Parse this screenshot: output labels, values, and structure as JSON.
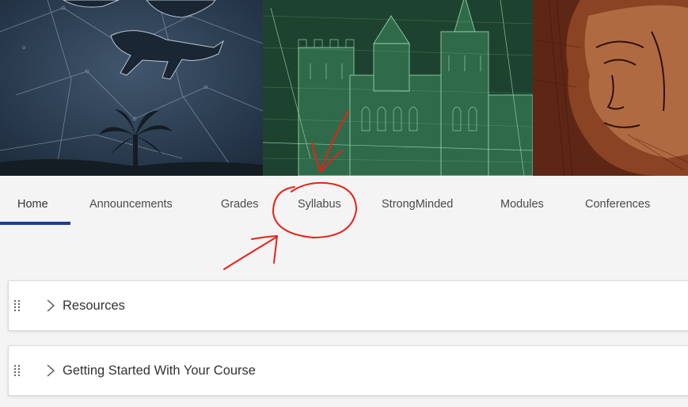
{
  "nav": {
    "tabs": [
      {
        "label": "Home",
        "active": true
      },
      {
        "label": "Announcements",
        "active": false
      },
      {
        "label": "Grades",
        "active": false
      },
      {
        "label": "Syllabus",
        "active": false
      },
      {
        "label": "StrongMinded",
        "active": false
      },
      {
        "label": "Modules",
        "active": false
      },
      {
        "label": "Conferences",
        "active": false
      }
    ]
  },
  "modules": [
    {
      "title": "Resources",
      "expanded": false
    },
    {
      "title": "Getting Started With Your Course",
      "expanded": false
    }
  ],
  "banner": {
    "panels": [
      "star-chart-cave-art",
      "green-castle-engraving",
      "red-chalk-portrait"
    ]
  },
  "colors": {
    "active_tab_underline": "#1e3d8f",
    "annotation_red": "#e8201a",
    "page_background": "#f4f4f4"
  }
}
